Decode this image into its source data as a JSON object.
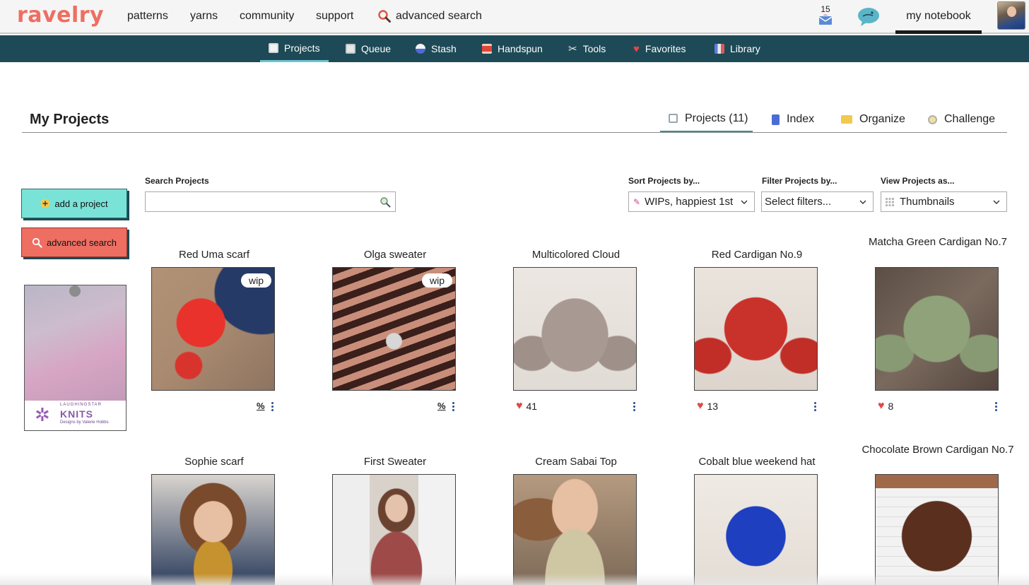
{
  "brand": "ravelry",
  "topnav": {
    "patterns": "patterns",
    "yarns": "yarns",
    "community": "community",
    "support": "support",
    "advanced_search": "advanced search",
    "mail_count": "15",
    "my_notebook": "my notebook"
  },
  "subnav": {
    "items": [
      "Projects",
      "Queue",
      "Stash",
      "Handspun",
      "Tools",
      "Favorites",
      "Library"
    ],
    "active": "Projects"
  },
  "page": {
    "title": "My Projects",
    "tabs": [
      "Projects (11)",
      "Index",
      "Organize",
      "Challenge"
    ],
    "active_tab": "Projects (11)"
  },
  "sidebar": {
    "add_project": "add a project",
    "advanced_search": "advanced search",
    "ad": {
      "line1": "LAUGHINGSTAR",
      "line2": "KNITS",
      "line3": "Designs by Valerie Hobbs"
    }
  },
  "controls": {
    "search_label": "Search Projects",
    "search_value": "",
    "sort_label": "Sort Projects by...",
    "sort_value": "WIPs, happiest 1st",
    "filter_label": "Filter Projects by...",
    "filter_value": "Select filters...",
    "view_label": "View Projects as...",
    "view_value": "Thumbnails"
  },
  "projects": [
    {
      "name": "Red Uma scarf",
      "status": "wip",
      "pct": "%",
      "hearts": null
    },
    {
      "name": "Olga sweater",
      "status": "wip",
      "pct": "%",
      "hearts": null
    },
    {
      "name": "Multicolored Cloud",
      "status": "",
      "pct": "",
      "hearts": "41"
    },
    {
      "name": "Red Cardigan No.9",
      "status": "",
      "pct": "",
      "hearts": "13"
    },
    {
      "name": "Matcha Green Cardigan No.7",
      "status": "",
      "pct": "",
      "hearts": "8"
    },
    {
      "name": "Sophie scarf",
      "status": "",
      "pct": "",
      "hearts": null
    },
    {
      "name": "First Sweater",
      "status": "",
      "pct": "",
      "hearts": null
    },
    {
      "name": "Cream Sabai Top",
      "status": "",
      "pct": "",
      "hearts": null
    },
    {
      "name": "Cobalt blue weekend hat",
      "status": "",
      "pct": "",
      "hearts": null
    },
    {
      "name": "Chocolate Brown Cardigan No.7",
      "status": "",
      "pct": "",
      "hearts": null
    }
  ],
  "colors": {
    "brand": "#ee6e62",
    "subnav_bg": "#1d4a56",
    "add_button": "#7ae3d8",
    "search_button": "#ee6e62",
    "heart": "#e04848"
  }
}
